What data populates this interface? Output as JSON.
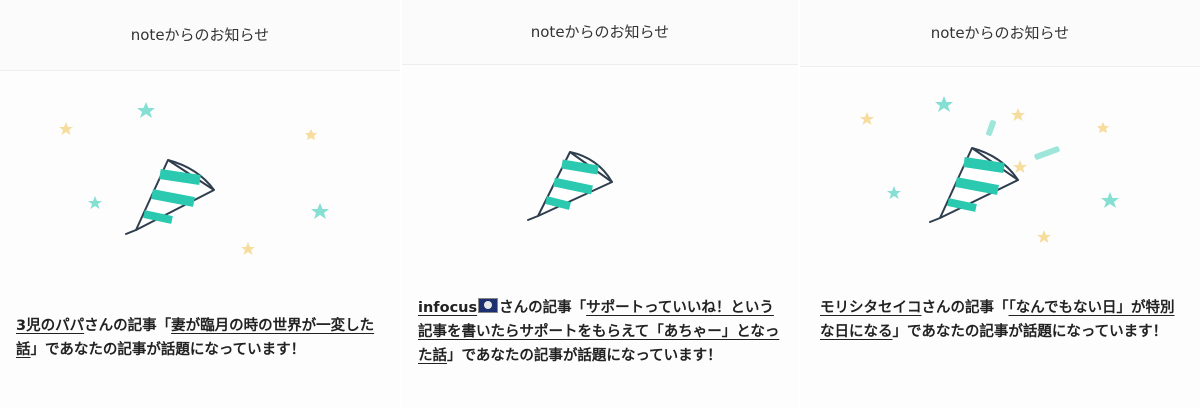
{
  "panels": [
    {
      "header": "noteからのお知らせ",
      "user": "3児のパパ",
      "suffix": "さんの記事「",
      "article_title": "妻が臨月の時の世界が一変した話",
      "tail": "」であなたの記事が話題になっています！"
    },
    {
      "header": "noteからのお知らせ",
      "user": "infocus",
      "suffix": "さんの記事「",
      "article_title": "サポートっていいね！という記事を書いたらサポートをもらえて「あちゃー」となった話",
      "tail": "」であなたの記事が話題になっています！"
    },
    {
      "header": "noteからのお知らせ",
      "user": "モリシタセイコ",
      "suffix": "さんの記事「",
      "article_title": "「なんでもない日」が特別な日になる",
      "tail": "」であなたの記事が話題になっています！"
    }
  ],
  "colors": {
    "teal": "#2ac9b0",
    "star_yellow": "#f6dd9e",
    "star_teal": "#86dfd3"
  },
  "icons": [
    "party-popper-icon",
    "star-icon",
    "korea-flag-icon"
  ]
}
